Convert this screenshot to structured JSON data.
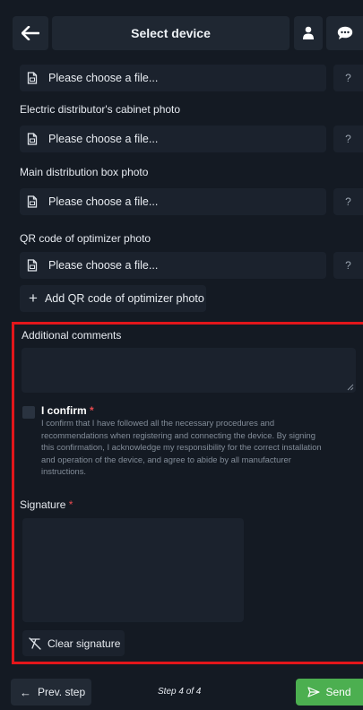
{
  "header": {
    "title": "Select device",
    "back_icon": "arrow-left-icon",
    "user_icon": "user-icon",
    "chat_icon": "chat-bubble-icon"
  },
  "uploads": [
    {
      "label": "",
      "placeholder": "Please choose a file...",
      "help": "?"
    },
    {
      "label": "Electric distributor's cabinet photo",
      "placeholder": "Please choose a file...",
      "help": "?"
    },
    {
      "label": "Main distribution box photo",
      "placeholder": "Please choose a file...",
      "help": "?"
    },
    {
      "label": "QR code of optimizer photo",
      "placeholder": "Please choose a file...",
      "help": "?"
    }
  ],
  "add_button": {
    "plus": "+",
    "label": "Add QR code of optimizer photo"
  },
  "comments": {
    "label": "Additional comments",
    "value": ""
  },
  "confirm": {
    "title": "I confirm",
    "required_mark": "*",
    "text": "I confirm that I have followed all the necessary procedures and recommendations when registering and connecting the device. By signing this confirmation, I acknowledge my responsibility for the correct installation and operation of the device, and agree to abide by all manufacturer instructions.",
    "checked": false
  },
  "signature": {
    "label": "Signature",
    "required_mark": "*",
    "clear_label": "Clear signature"
  },
  "footer": {
    "prev_arrow": "←",
    "prev_label": "Prev. step",
    "step_text": "Step 4 of 4",
    "send_label": "Send"
  },
  "colors": {
    "background": "#141a23",
    "panel": "#1b222d",
    "highlight_border": "#e3161b",
    "send_green": "#4caf50",
    "required_red": "#e84a4f"
  }
}
